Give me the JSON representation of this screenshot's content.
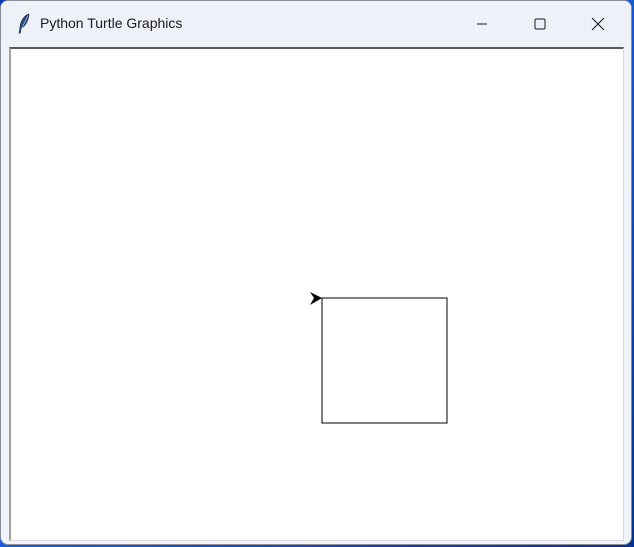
{
  "window": {
    "title": "Python Turtle Graphics",
    "app_icon": "feather-icon",
    "controls": {
      "minimize_icon": "minimize-icon",
      "maximize_icon": "maximize-icon",
      "close_icon": "close-icon"
    }
  },
  "canvas": {
    "background": "#ffffff",
    "pen_color": "#000000",
    "turtle_shape": "classic-arrow"
  },
  "colors": {
    "titlebar": "#eef1f8",
    "title_text": "#1b1b1b",
    "desktop": "#1a5fe0"
  }
}
